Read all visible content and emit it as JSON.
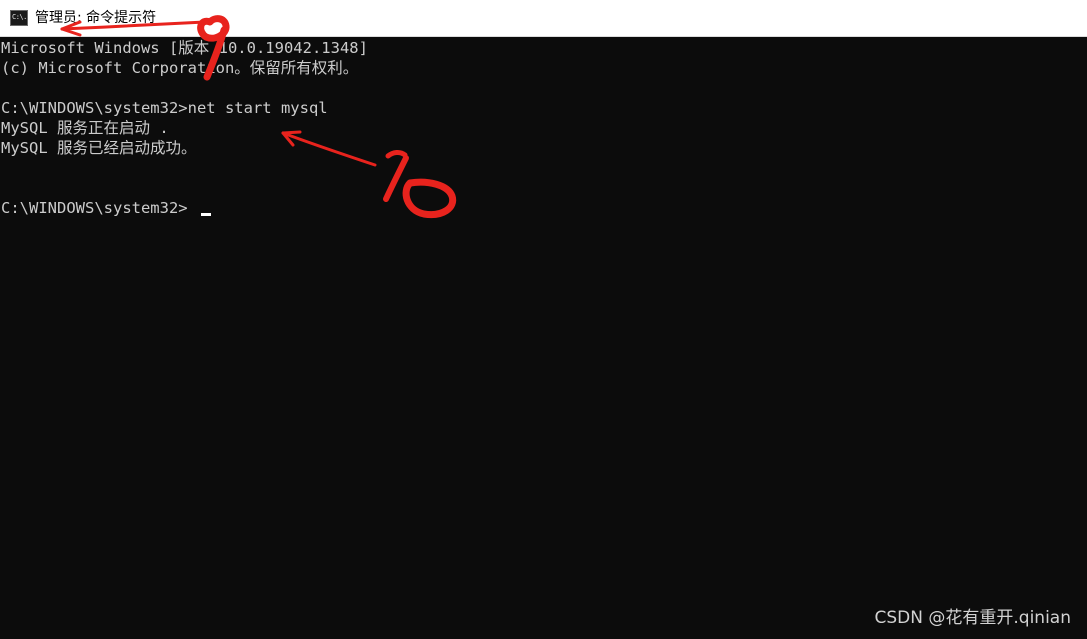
{
  "window": {
    "title": "管理员: 命令提示符",
    "icon": "cmd-icon",
    "icon_text": "C:\\."
  },
  "console": {
    "lines": [
      "Microsoft Windows [版本 10.0.19042.1348]",
      "(c) Microsoft Corporation。保留所有权利。",
      "",
      "C:\\WINDOWS\\system32>net start mysql",
      "MySQL 服务正在启动 .",
      "MySQL 服务已经启动成功。",
      "",
      "",
      "C:\\WINDOWS\\system32>"
    ]
  },
  "annotations": {
    "label_9": "9",
    "label_10": "10",
    "color": "#e8231d"
  },
  "watermark": "CSDN @花有重开.qinian"
}
